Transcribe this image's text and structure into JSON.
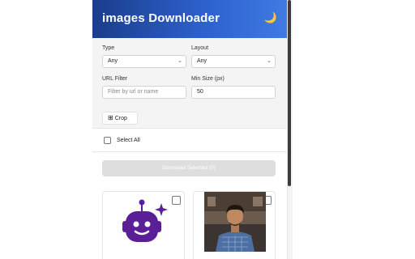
{
  "header": {
    "title": "images Downloader",
    "theme_icon": "moon-icon"
  },
  "form": {
    "type_label": "Type",
    "type_value": "Any",
    "layout_label": "Layout",
    "layout_value": "Any",
    "url_filter_label": "URL Filter",
    "url_filter_placeholder": "Filter by url or name",
    "url_filter_value": "",
    "min_size_label": "Min Size (px)",
    "min_size_value": "50",
    "crop_label": "Crop"
  },
  "select_all_label": "Select All",
  "download_label": "Download Selected (0)",
  "cards": [
    {
      "image": "robot-logo",
      "selected": false
    },
    {
      "image": "person-photo",
      "selected": false
    }
  ],
  "colors": {
    "header_start": "#1a3d8c",
    "header_end": "#3f7ae2",
    "robot_purple": "#5a1f96"
  }
}
